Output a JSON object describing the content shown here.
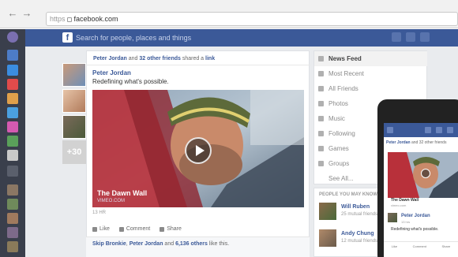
{
  "browser": {
    "back": "←",
    "forward": "→",
    "url_scheme": "https",
    "url_host": "facebook.com"
  },
  "fb_header": {
    "logo": "f",
    "search_placeholder": "Search for people, places and things"
  },
  "story": {
    "header_name": "Peter Jordan",
    "header_mid": " and ",
    "header_friends": "32 other friends",
    "header_action": " shared a ",
    "header_object": "link",
    "author": "Peter Jordan",
    "text": "Redefining what's possible.",
    "video_title": "The Dawn Wall",
    "video_source": "VIMEO.COM",
    "timestamp": "13 HR",
    "like_label": "Like",
    "comment_label": "Comment",
    "share_label": "Share",
    "likes_a": "Skip Bronkie",
    "likes_sep1": ", ",
    "likes_b": "Peter Jordan",
    "likes_sep2": " and ",
    "likes_c": "6,136 others",
    "likes_tail": " like this."
  },
  "more_count": "+30",
  "right_nav": {
    "items": [
      {
        "label": "News Feed",
        "icon": "news-feed-icon"
      },
      {
        "label": "Most Recent",
        "icon": "clock-icon"
      },
      {
        "label": "All Friends",
        "icon": "friends-icon"
      },
      {
        "label": "Photos",
        "icon": "photos-icon"
      },
      {
        "label": "Music",
        "icon": "music-icon"
      },
      {
        "label": "Following",
        "icon": "following-icon"
      },
      {
        "label": "Games",
        "icon": "games-icon"
      },
      {
        "label": "Groups",
        "icon": "groups-icon"
      },
      {
        "label": "See All...",
        "icon": ""
      }
    ]
  },
  "pymk": {
    "title": "PEOPLE YOU MAY KNOW",
    "people": [
      {
        "name": "Will Ruben",
        "mutual": "25 mutual friends"
      },
      {
        "name": "Andy Chung",
        "mutual": "12 mutual friends"
      }
    ]
  },
  "phone": {
    "header_name": "Peter Jordan",
    "header_rest": " and 32 other friends",
    "video_title": "The Dawn Wall",
    "video_source": "vimeo.com",
    "author": "Peter Jordan",
    "timestamp": "13 hrs",
    "text": "Redefining what's possible.",
    "like": "Like",
    "comment": "Comment",
    "share": "Share"
  },
  "colors": {
    "fb_blue": "#3b5998",
    "sidebar_dark": "#3a3f4c",
    "page_bg": "#e9ebee"
  }
}
